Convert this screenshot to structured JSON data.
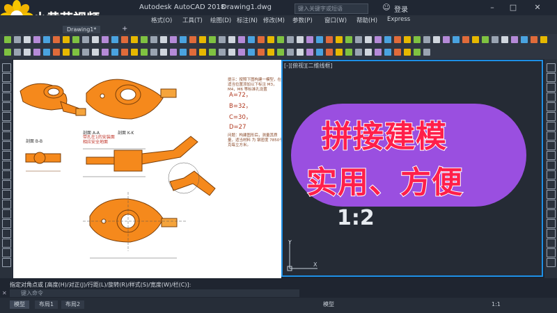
{
  "window": {
    "app_title": "Autodesk AutoCAD 2018",
    "file_name": "Drawing1.dwg",
    "search_placeholder": "键入关键字或短语",
    "login_label": "登录"
  },
  "watermark": {
    "text": "小黄花视频"
  },
  "menu": {
    "items": [
      "格式(O)",
      "工具(T)",
      "绘图(D)",
      "标注(N)",
      "修改(M)",
      "参数(P)",
      "窗口(W)",
      "帮助(H)",
      "Express"
    ]
  },
  "tabs": {
    "drawing": "Drawing1*"
  },
  "viewport": {
    "label": "[-][俯视][二维线框]"
  },
  "reference_doc": {
    "notes": "提示：按照下图构建一模型，在适当位置添加以下标注 M3，M4，M6 等标准孔设置",
    "equations": [
      "A=72，",
      "B=32，",
      "C=30，",
      "D=27"
    ],
    "footer_note": "问题：构建图形后，测量其质量，适当材料 为 钢密度 7850千克每立方米。",
    "section_labels": [
      "剖面 B-B",
      "剖面 A-A",
      "剖面 K-K"
    ],
    "red_note": "带孔在1的安装面\n相应安全地面"
  },
  "overlay": {
    "line1": "拼接建模",
    "line2": "实用、方便",
    "scale_text": "1:2"
  },
  "ucs": {
    "y": "Y",
    "x": "X"
  },
  "command": {
    "history": "指定对角点或 [高度(H)/对正(J)/行距(L)/旋转(R)/样式(S)/宽度(W)/栏(C)]:",
    "placeholder": "键入命令"
  },
  "status": {
    "layout_tabs": [
      "模型",
      "布局1",
      "布局2"
    ],
    "model_label": "模型",
    "scale": "1:1"
  },
  "colors": {
    "accent_border": "#1e90e6",
    "pill": "#9a4fe0",
    "overlay_text": "#ff1f4a",
    "part_orange": "#f5891c"
  }
}
